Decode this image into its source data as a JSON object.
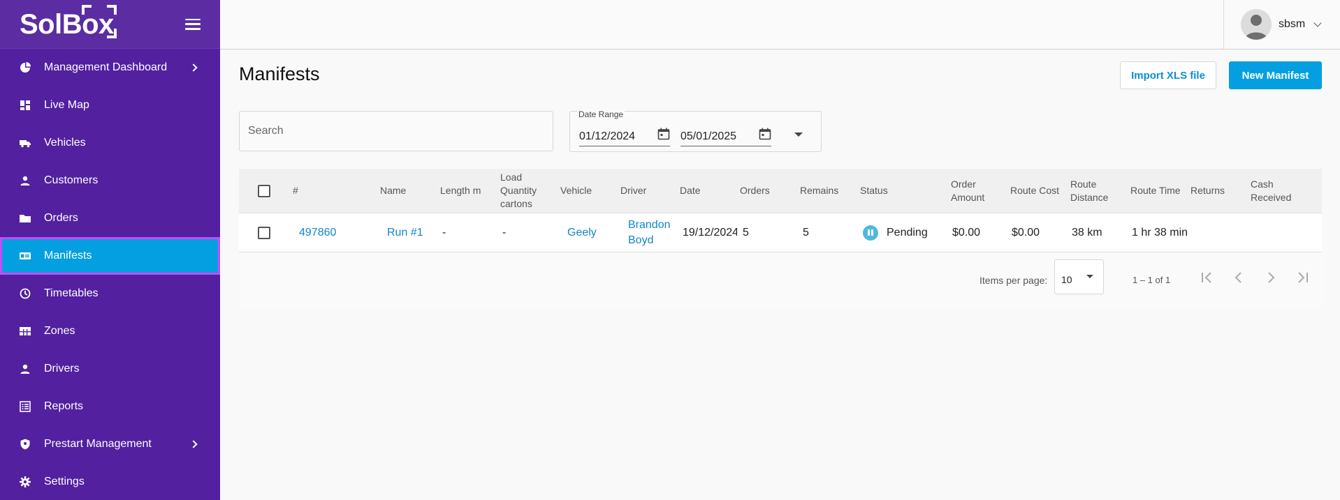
{
  "brand": {
    "name": "SolBox"
  },
  "sidebar": {
    "items": [
      {
        "label": "Management Dashboard",
        "icon": "pie-chart-icon",
        "has_children": true
      },
      {
        "label": "Live Map",
        "icon": "dashboard-icon",
        "has_children": false
      },
      {
        "label": "Vehicles",
        "icon": "truck-icon",
        "has_children": false
      },
      {
        "label": "Customers",
        "icon": "person-icon",
        "has_children": false
      },
      {
        "label": "Orders",
        "icon": "folder-icon",
        "has_children": false
      },
      {
        "label": "Manifests",
        "icon": "id-card-icon",
        "has_children": false,
        "active": true
      },
      {
        "label": "Timetables",
        "icon": "clock-icon",
        "has_children": false
      },
      {
        "label": "Zones",
        "icon": "grid-icon",
        "has_children": false
      },
      {
        "label": "Drivers",
        "icon": "person-icon",
        "has_children": false
      },
      {
        "label": "Reports",
        "icon": "list-icon",
        "has_children": false
      },
      {
        "label": "Prestart Management",
        "icon": "shield-icon",
        "has_children": true
      },
      {
        "label": "Settings",
        "icon": "gear-icon",
        "has_children": false
      }
    ]
  },
  "topbar": {
    "username": "sbsm"
  },
  "page": {
    "title": "Manifests",
    "import_label": "Import XLS file",
    "new_label": "New Manifest"
  },
  "filters": {
    "search_placeholder": "Search",
    "date_range_label": "Date Range",
    "start_date": "01/12/2024",
    "end_date": "05/01/2025"
  },
  "table": {
    "columns": [
      "#",
      "Name",
      "Length m",
      "Load Quantity cartons",
      "Vehicle",
      "Driver",
      "Date",
      "Orders",
      "Remains",
      "Status",
      "Order Amount",
      "Route Cost",
      "Route Distance",
      "Route Time",
      "Returns",
      "Cash Received"
    ],
    "rows": [
      {
        "id": "497860",
        "name": "Run #1",
        "length": "-",
        "load": "-",
        "vehicle": "Geely",
        "driver": "Brandon Boyd",
        "date": "19/12/2024",
        "orders": "5",
        "remains": "5",
        "status": "Pending",
        "order_amount": "$0.00",
        "route_cost": "$0.00",
        "route_distance": "38 km",
        "route_time": "1 hr 38 min",
        "returns": "",
        "cash_received": ""
      }
    ]
  },
  "paginator": {
    "items_per_page_label": "Items per page:",
    "page_size": "10",
    "range": "1 – 1 of 1"
  },
  "colors": {
    "sidebar_bg": "#5320a0",
    "accent": "#049fe0",
    "active_outline": "#c64cf5",
    "link": "#1187c9"
  }
}
